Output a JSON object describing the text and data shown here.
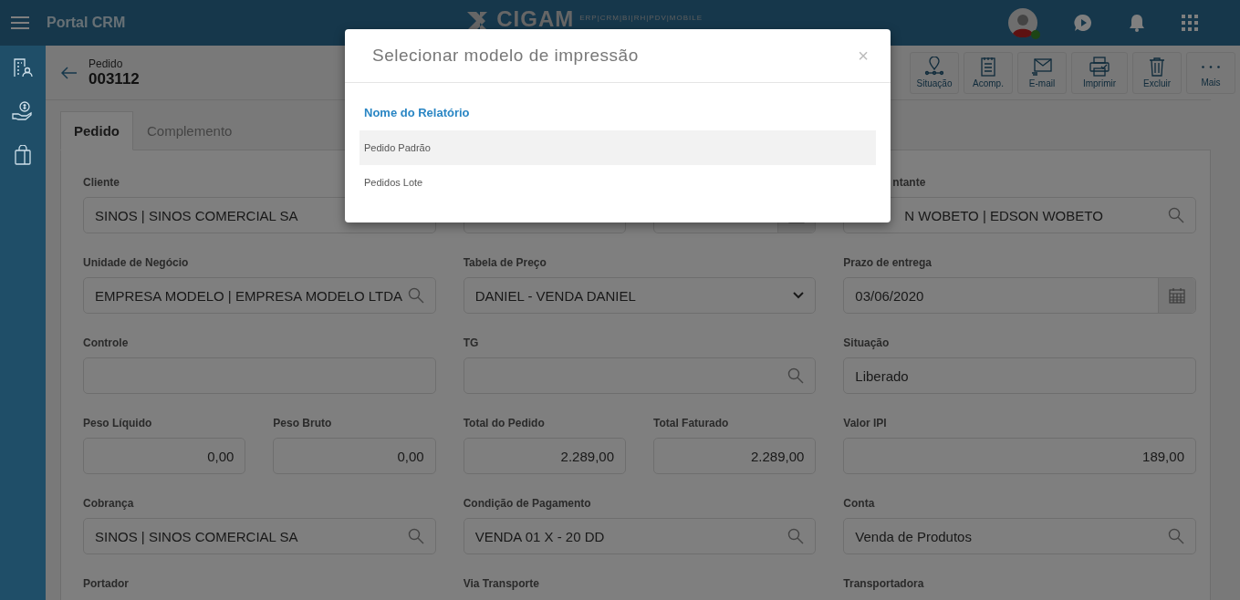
{
  "header": {
    "title": "Portal CRM",
    "logo": "CIGAM",
    "tagline": "ERP|CRM|BI|RH|PDV|MOBILE",
    "user_online": true
  },
  "record": {
    "label": "Pedido",
    "number": "003112"
  },
  "toolbar": [
    {
      "label": "Situação",
      "kind": "pin"
    },
    {
      "label": "Acomp.",
      "kind": "notes"
    },
    {
      "label": "E-mail",
      "kind": "mail"
    },
    {
      "label": "Imprimir",
      "kind": "print"
    },
    {
      "label": "Excluir",
      "kind": "trash"
    },
    {
      "label": "Mais",
      "kind": "more"
    }
  ],
  "tabs": [
    {
      "label": "Pedido",
      "selected": true
    },
    {
      "label": "Complemento",
      "selected": false
    }
  ],
  "form_rows": [
    [
      {
        "label": "Cliente",
        "value": "SINOS | SINOS COMERCIAL SA",
        "kind": "text",
        "half": false
      },
      {
        "kind": "text",
        "half": true
      },
      {
        "kind": "date",
        "half": true
      },
      {
        "label": "ntante",
        "value": "N WOBETO | EDSON WOBETO",
        "kind": "search",
        "half": false,
        "partial": true
      }
    ],
    [
      {
        "label": "Unidade de Negócio",
        "value": "EMPRESA MODELO | EMPRESA MODELO LTDA",
        "kind": "search",
        "half": false
      },
      {
        "label": "Tabela de Preço",
        "value": "DANIEL - VENDA DANIEL",
        "kind": "select",
        "half": false
      },
      {
        "label": "Prazo de entrega",
        "value": "03/06/2020",
        "kind": "date",
        "half": false
      }
    ],
    [
      {
        "label": "Controle",
        "kind": "text",
        "half": false
      },
      {
        "label": "TG",
        "kind": "search",
        "half": false
      },
      {
        "label": "Situação",
        "value": "Liberado",
        "kind": "text",
        "half": false
      }
    ],
    [
      {
        "label": "Peso Líquido",
        "value": "0,00",
        "kind": "number",
        "half": true
      },
      {
        "label": "Peso Bruto",
        "value": "0,00",
        "kind": "number",
        "half": true
      },
      {
        "label": "Total do Pedido",
        "value": "2.289,00",
        "kind": "number",
        "half": true
      },
      {
        "label": "Total Faturado",
        "value": "2.289,00",
        "kind": "number",
        "half": true
      },
      {
        "label": "Valor IPI",
        "value": "189,00",
        "kind": "number",
        "half": false
      }
    ],
    [
      {
        "label": "Cobrança",
        "value": "SINOS | SINOS COMERCIAL SA",
        "kind": "search",
        "half": false
      },
      {
        "label": "Condição de Pagamento",
        "value": "VENDA 01 X - 20 DD",
        "kind": "search",
        "half": false
      },
      {
        "label": "Conta",
        "value": "Venda de Produtos",
        "kind": "search",
        "half": false
      }
    ],
    [
      {
        "label": "Portador",
        "half": false
      },
      {
        "label": "Via Transporte",
        "half": false
      },
      {
        "label": "Transportadora",
        "half": false
      }
    ]
  ],
  "dialog": {
    "title": "Selecionar modelo de impressão",
    "close": "×",
    "column": "Nome do Relatório",
    "rows": [
      {
        "name": "Pedido Padrão",
        "selected": true
      },
      {
        "name": "Pedidos Lote",
        "selected": false
      }
    ]
  }
}
